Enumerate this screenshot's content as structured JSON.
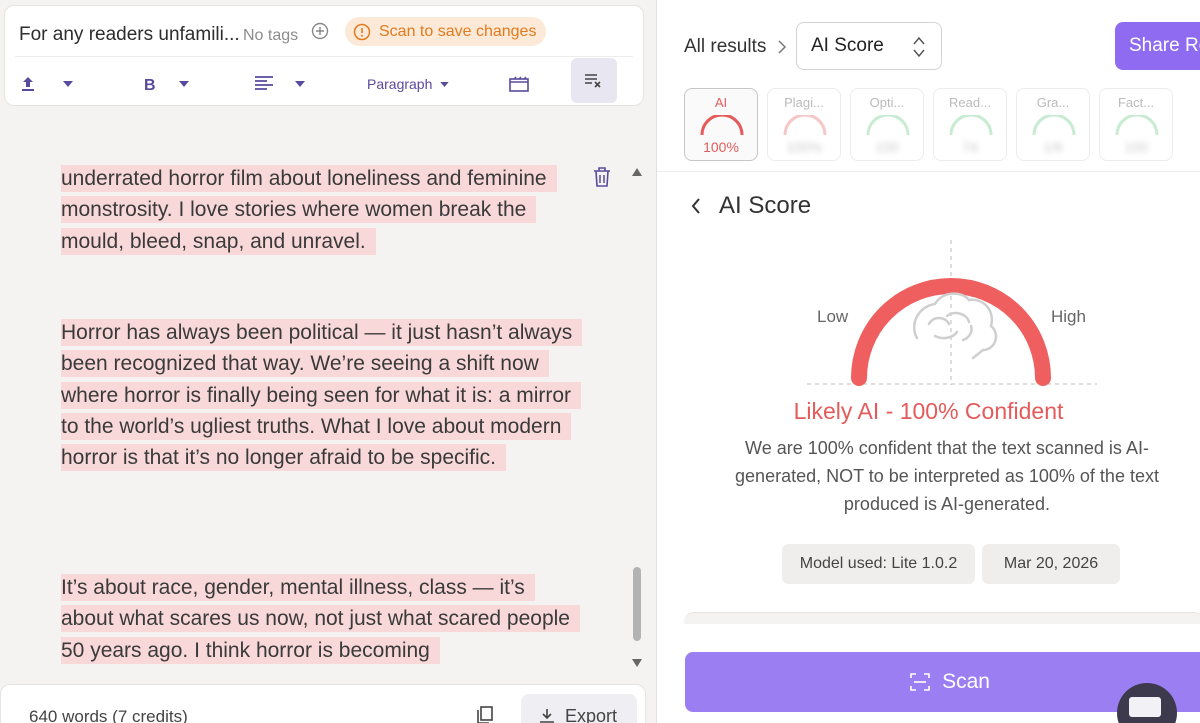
{
  "editor_header": {
    "doc_title": "For any readers unfamili...",
    "no_tags": "No tags",
    "scan_badge": "Scan to save changes",
    "paragraph_style": "Paragraph"
  },
  "editor": {
    "paragraphs": [
      "underrated horror film about loneliness and feminine monstrosity. I love stories where women break the mould, bleed, snap, and unravel.",
      "Horror has always been political — it just hasn’t always been recognized that way. We’re seeing a shift now where horror is finally being seen for what it is: a mirror to the world’s ugliest truths. What I love about modern horror is that it’s no longer afraid to be specific.",
      "It’s about race, gender, mental illness, class — it’s about what scares us now, not just what scared people 50 years ago. I think horror is becoming"
    ]
  },
  "editor_footer": {
    "word_count": "640 words (7 credits)",
    "export_label": "Export"
  },
  "results": {
    "breadcrumb_all": "All results",
    "selected_view": "AI Score",
    "share_label": "Share Re",
    "tabs": [
      {
        "label": "AI",
        "value": "100%"
      },
      {
        "label": "Plagi...",
        "value": "100%"
      },
      {
        "label": "Opti...",
        "value": "100"
      },
      {
        "label": "Read...",
        "value": "74"
      },
      {
        "label": "Gra...",
        "value": "1/6"
      },
      {
        "label": "Fact...",
        "value": "100"
      }
    ],
    "section_title": "AI Score",
    "gauge": {
      "low": "Low",
      "high": "High",
      "score_fraction": 1.0,
      "color": "#ef5f5f"
    },
    "verdict": "Likely AI - 100% Confident",
    "explanation": "We are 100% confident that the text scanned is AI-generated, NOT to be interpreted as 100% of the text produced is AI-generated.",
    "model_used": "Model used: Lite 1.0.2",
    "date": "Mar 20, 2026",
    "scan_label": "Scan"
  },
  "colors": {
    "accent": "#9b7ef2",
    "ai_red": "#e55b5b",
    "highlight": "#f8d8d8",
    "warning": "#e07b1f"
  }
}
